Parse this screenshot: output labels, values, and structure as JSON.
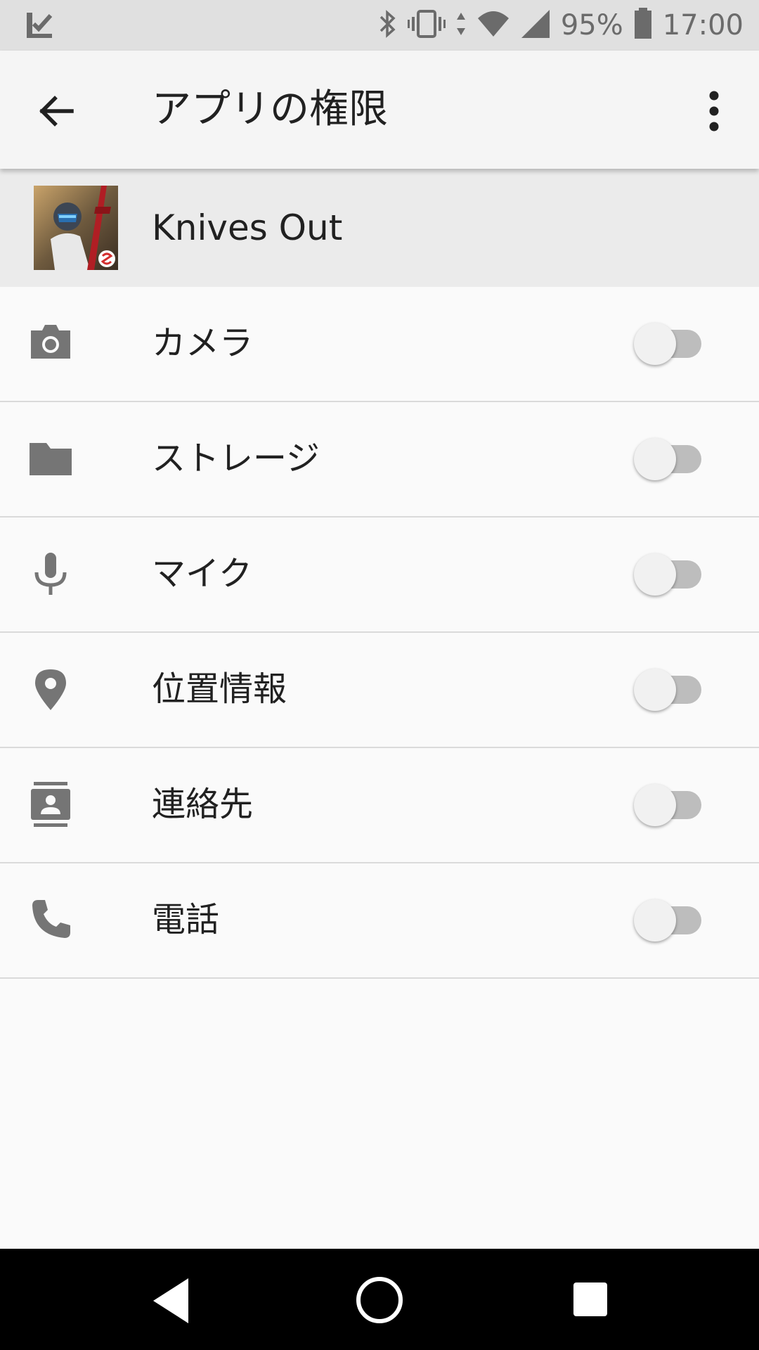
{
  "status_bar": {
    "battery_percent": "95%",
    "time": "17:00",
    "icons": [
      "notification-check-icon",
      "bluetooth-icon",
      "vibrate-icon",
      "data-arrows-icon",
      "wifi-icon",
      "signal-icon",
      "battery-icon"
    ]
  },
  "app_bar": {
    "title": "アプリの権限",
    "back_icon": "arrow-back-icon",
    "overflow_icon": "more-vert-icon"
  },
  "app": {
    "name": "Knives Out",
    "icon": "knives-out-app-icon"
  },
  "permissions": [
    {
      "label": "カメラ",
      "icon": "camera-icon",
      "enabled": false
    },
    {
      "label": "ストレージ",
      "icon": "folder-icon",
      "enabled": false
    },
    {
      "label": "マイク",
      "icon": "mic-icon",
      "enabled": false
    },
    {
      "label": "位置情報",
      "icon": "location-pin-icon",
      "enabled": false
    },
    {
      "label": "連絡先",
      "icon": "contacts-icon",
      "enabled": false
    },
    {
      "label": "電話",
      "icon": "phone-icon",
      "enabled": false
    }
  ],
  "colors": {
    "status_bar_bg": "#e0e0e0",
    "app_bar_bg": "#f5f5f5",
    "header_bg": "#ebebeb",
    "icon_gray": "#757575",
    "text_primary": "#212121",
    "toggle_track_off": "#bdbdbd",
    "toggle_thumb_off": "#f1f1f1",
    "nav_bar_bg": "#000000"
  },
  "nav_bar": {
    "icons": [
      "nav-back-icon",
      "nav-home-icon",
      "nav-recents-icon"
    ]
  }
}
